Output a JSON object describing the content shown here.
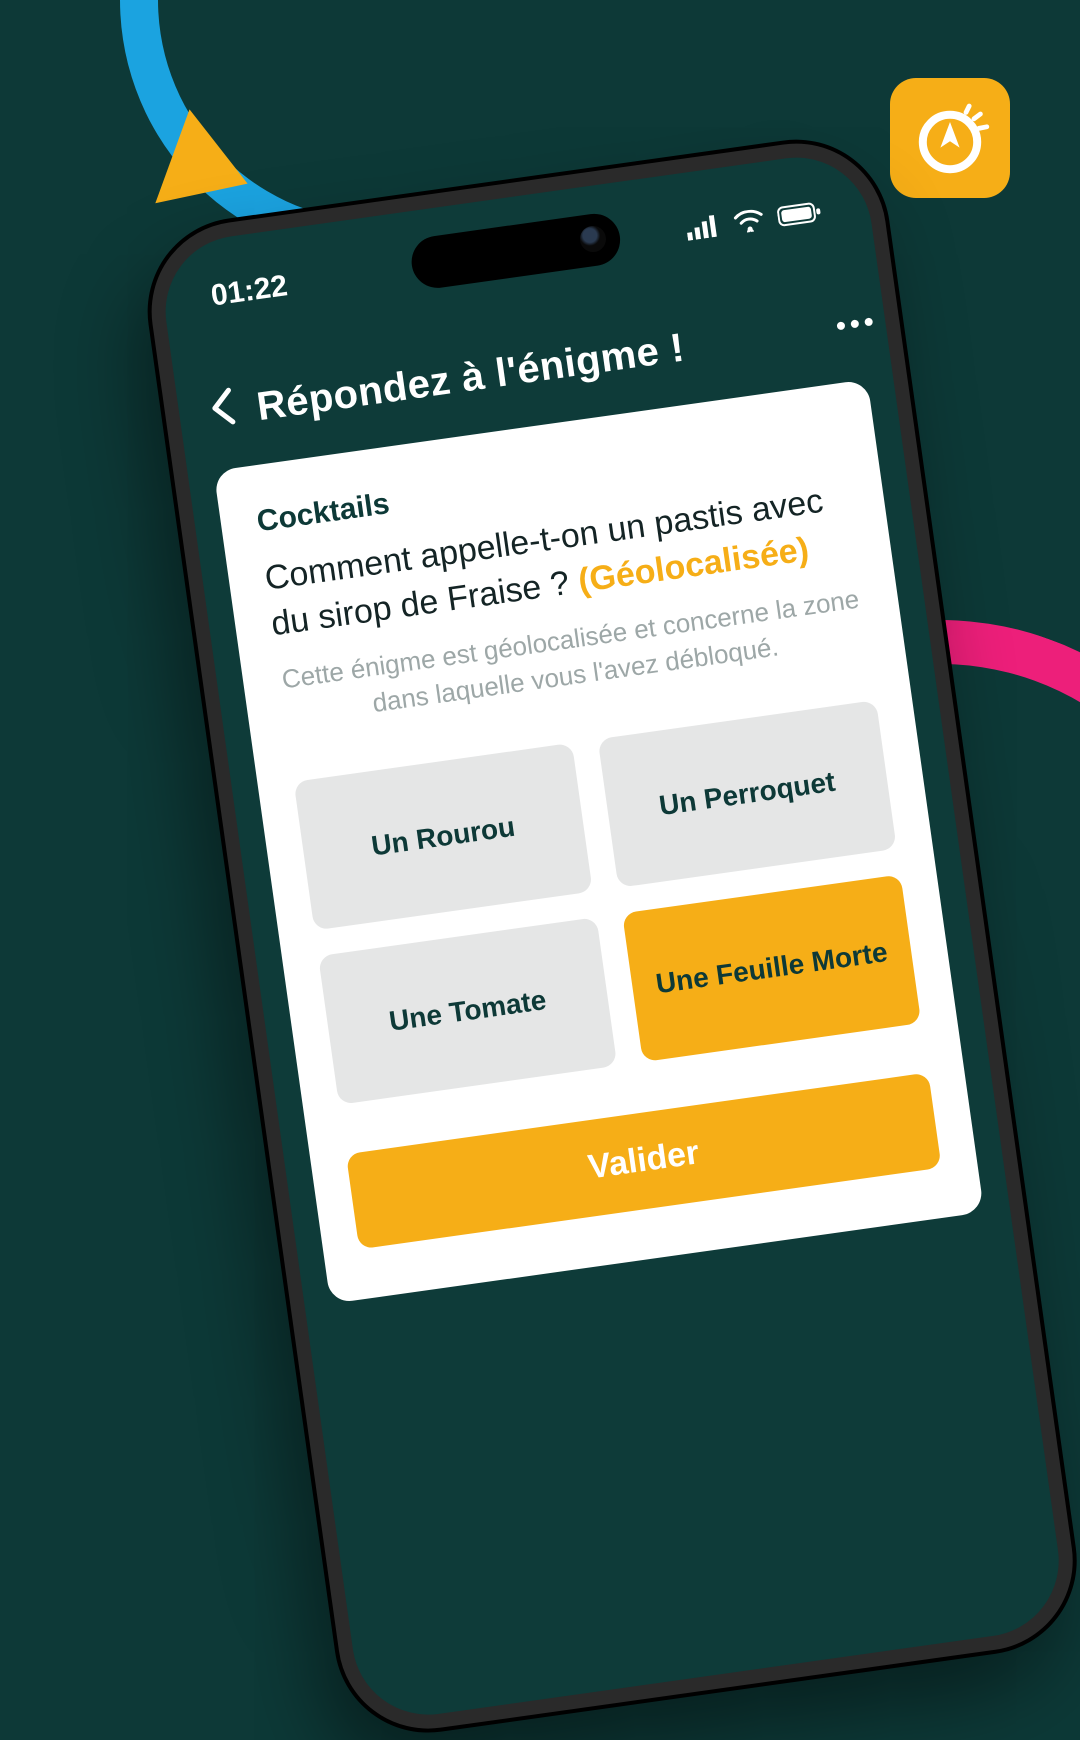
{
  "colors": {
    "bg": "#0d3937",
    "accent": "#f6ae17",
    "blue": "#1ba3e0",
    "pink": "#ed1f7a"
  },
  "badge": {
    "icon": "compass-dial-icon"
  },
  "status": {
    "time": "01:22"
  },
  "header": {
    "back_icon": "chevron-left-icon",
    "title": "Répondez à l'énigme !",
    "menu_icon": "more-vertical-icon"
  },
  "card": {
    "category": "Cocktails",
    "question": "Comment appelle-t-on un pastis avec du sirop de Fraise ?",
    "tag": "(Géolocalisée)",
    "hint": "Cette énigme est géolocalisée et concerne la zone dans laquelle vous l'avez débloqué.",
    "options": [
      {
        "label": "Un Rourou",
        "selected": false
      },
      {
        "label": "Un Perroquet",
        "selected": false
      },
      {
        "label": "Une Tomate",
        "selected": false
      },
      {
        "label": "Une Feuille Morte",
        "selected": true
      }
    ],
    "validate_label": "Valider"
  }
}
